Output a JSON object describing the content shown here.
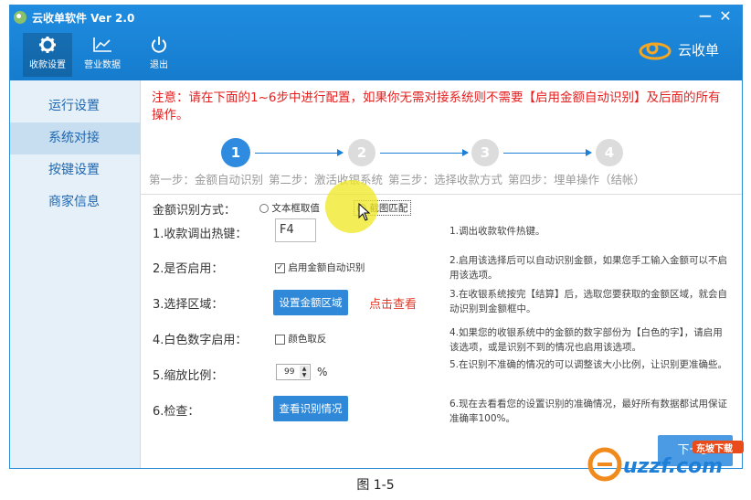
{
  "app": {
    "title": "云收单软件 Ver 2.0",
    "minimize": "−",
    "close": "✕"
  },
  "toolbar": [
    {
      "label": "收款设置",
      "icon": "gear-icon",
      "glyph": "✿"
    },
    {
      "label": "营业数据",
      "icon": "chart-icon",
      "glyph": "📈"
    },
    {
      "label": "退出",
      "icon": "power-icon",
      "glyph": "⏻"
    }
  ],
  "brand": {
    "name": "云收单"
  },
  "sidebar": {
    "items": [
      {
        "label": "运行设置"
      },
      {
        "label": "系统对接"
      },
      {
        "label": "按键设置"
      },
      {
        "label": "商家信息"
      }
    ]
  },
  "notice": "注意：请在下面的1~6步中进行配置，如果你无需对接系统则不需要【启用金额自动识别】及后面的所有操作。",
  "steps": {
    "circles": [
      "1",
      "2",
      "3",
      "4"
    ],
    "labels": [
      "第一步：金额自动识别",
      "第二步：激活收银系统",
      "第三步：选择收款方式",
      "第四步：埋单操作（结帐）"
    ]
  },
  "form": {
    "method_label": "金额识别方式：",
    "method_option1": "文本框取值",
    "method_option2": "截图匹配",
    "hotkey_label": "1.收款调出热键：",
    "hotkey_value": "F4",
    "hotkey_hint": "1.调出收款软件热键。",
    "enable_label": "2.是否启用：",
    "enable_option": "启用金额自动识别",
    "enable_hint": "2.启用该选择后可以自动识别金额，如果您手工输入金额可以不启用该选项。",
    "region_label": "3.选择区域：",
    "region_button": "设置金额区域",
    "region_link": "点击查看",
    "region_hint": "3.在收银系统按完【结算】后，选取您要获取的金额区域，就会自动识别到金额框中。",
    "white_label": "4.白色数字启用：",
    "white_option": "颜色取反",
    "white_hint": "4.如果您的收银系统中的金额的数字部份为【白色的字】，请启用该选项，或是识别不到的情况也启用该选项。",
    "scale_label": "5.缩放比例：",
    "scale_value": "99",
    "scale_unit": "%",
    "scale_hint": "5.在识别不准确的情况的可以调整该大小比例，让识别更准确些。",
    "check_label": "6.检查：",
    "check_button": "查看识别情况",
    "check_hint": "6.现在去看看您的设置识别的准确情况，最好所有数据都试用保证准确率100%。"
  },
  "next_button": "下一步",
  "watermark": {
    "text": "uzzf.com",
    "badge": "东坡下载"
  },
  "caption": "图 1-5"
}
